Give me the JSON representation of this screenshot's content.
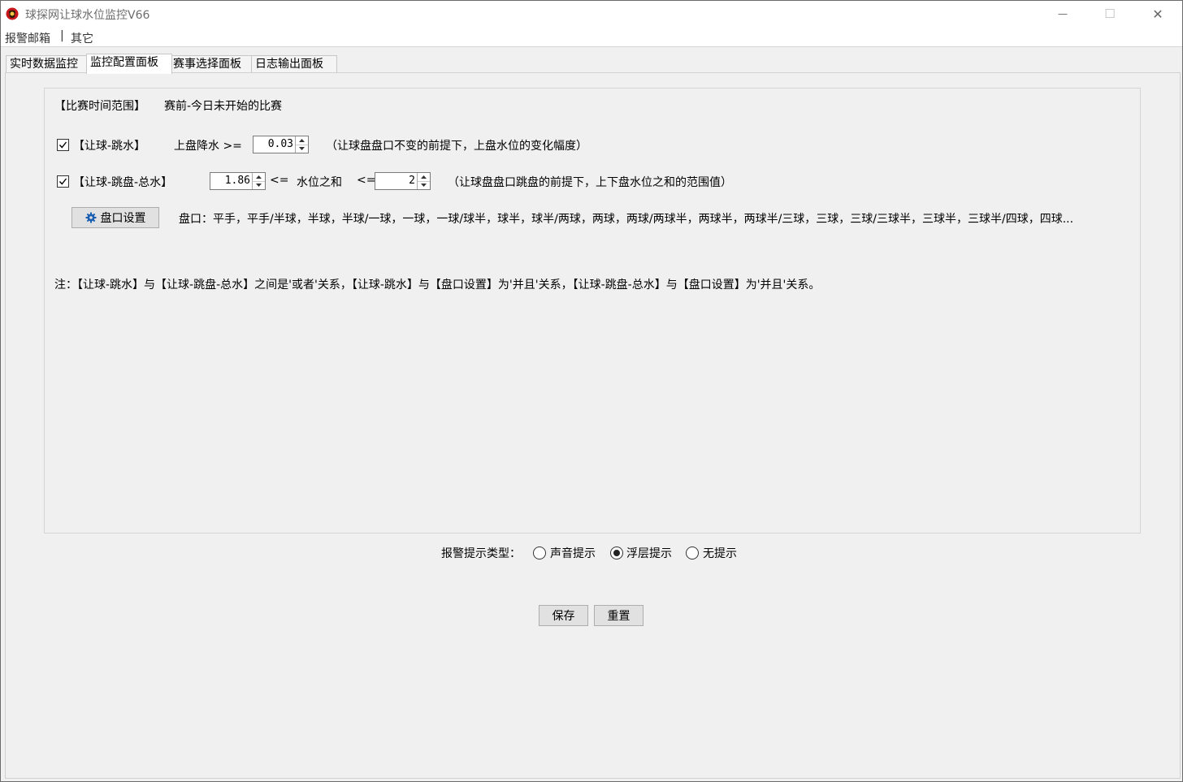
{
  "window": {
    "title": "球探网让球水位监控V66",
    "minimize_symbol": "—",
    "maximize_symbol": "☐",
    "close_symbol": "✕"
  },
  "menu": {
    "items": [
      "报警邮箱",
      "其它"
    ],
    "separator": "|"
  },
  "tabs": [
    "实时数据监控",
    "监控配置面板",
    "赛事选择面板",
    "日志输出面板"
  ],
  "active_tab": "监控配置面板",
  "config": {
    "time_range_label": "【比赛时间范围】",
    "time_range_value": "赛前-今日未开始的比赛",
    "rule1": {
      "checked": true,
      "label": "【让球-跳水】",
      "field_label": "上盘降水 >=",
      "value": "0.03",
      "note": "（让球盘盘口不变的前提下，上盘水位的变化幅度）"
    },
    "rule2": {
      "checked": true,
      "label": "【让球-跳盘-总水】",
      "min_value": "1.86",
      "op1": "<=",
      "middle_label": "水位之和",
      "op2": "<=",
      "max_value": "2",
      "note": "（让球盘盘口跳盘的前提下，上下盘水位之和的范围值）"
    },
    "pankou": {
      "button_label": "盘口设置",
      "icon": "gear-icon",
      "list_text": "盘口：平手，平手/半球，半球，半球/一球，一球，一球/球半，球半，球半/两球，两球，两球/两球半，两球半，两球半/三球，三球，三球/三球半，三球半，三球半/四球，四球..."
    },
    "note": "注：【让球-跳水】与【让球-跳盘-总水】之间是'或者'关系，【让球-跳水】与【盘口设置】为'并且'关系，【让球-跳盘-总水】与【盘口设置】为'并且'关系。"
  },
  "alert": {
    "label": "报警提示类型：",
    "options": [
      "声音提示",
      "浮层提示",
      "无提示"
    ],
    "selected": "浮层提示"
  },
  "buttons": {
    "save": "保存",
    "reset": "重置"
  },
  "colors": {
    "icon_red": "#c8161d",
    "gear_blue": "#1a5fb4"
  }
}
